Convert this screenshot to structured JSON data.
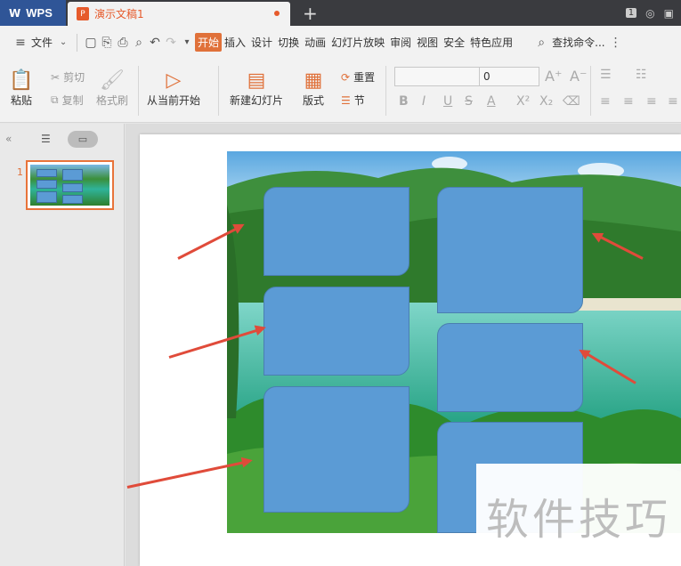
{
  "tabs": {
    "app_label": "WPS",
    "doc_label": "演示文稿1",
    "new_tab": "+",
    "badge": "1"
  },
  "menubar": {
    "file": "文件",
    "items": [
      "开始",
      "插入",
      "设计",
      "切换",
      "动画",
      "幻灯片放映",
      "审阅",
      "视图",
      "安全",
      "特色应用"
    ],
    "search": "查找命令..."
  },
  "ribbon": {
    "paste": "粘贴",
    "cut": "剪切",
    "copy": "复制",
    "format_painter": "格式刷",
    "play_from_current": "从当前开始",
    "new_slide": "新建幻灯片",
    "layout": "版式",
    "reset": "重置",
    "section": "节",
    "font_size": "0"
  },
  "slides_panel": {
    "slide_number": "1"
  },
  "watermark": {
    "text": "软件技巧"
  },
  "colors": {
    "accent": "#e0713a",
    "shape_fill": "#5b9bd5",
    "arrow": "#e04b3a",
    "wps_blue": "#2f5597"
  }
}
